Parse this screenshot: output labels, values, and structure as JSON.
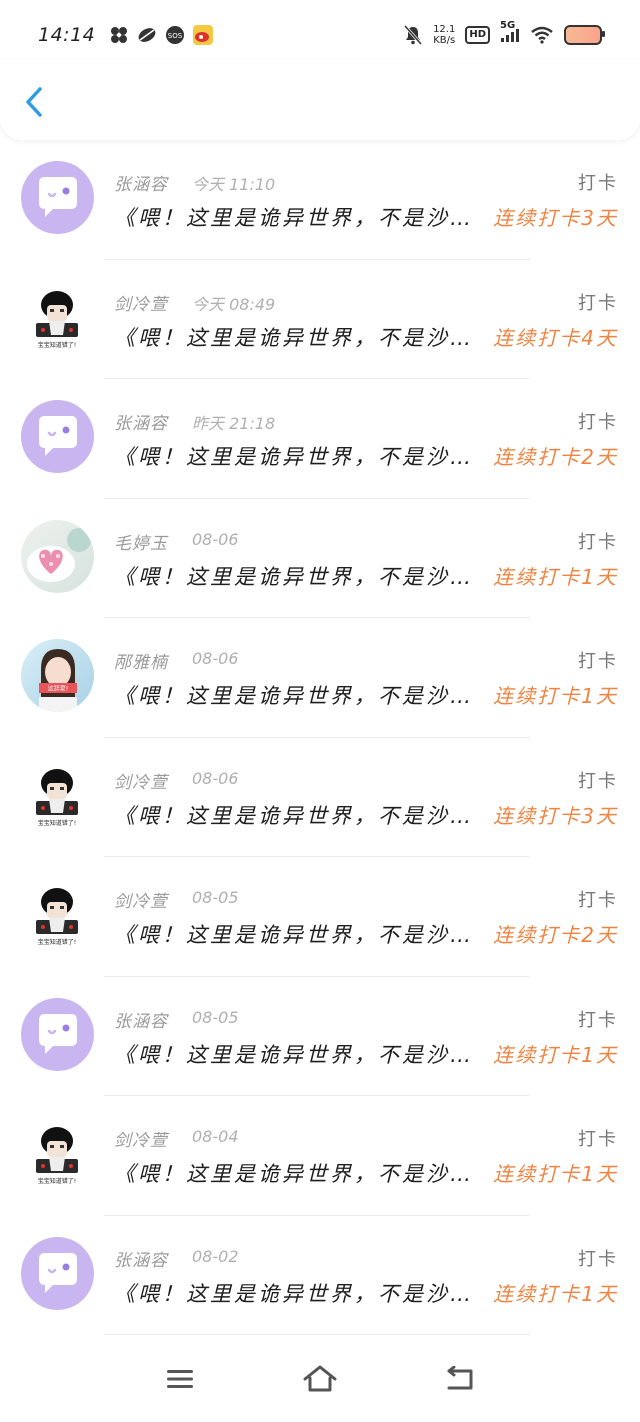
{
  "status_bar": {
    "time": "14:14",
    "speed_value": "12.1",
    "speed_unit": "KB/s",
    "hd": "HD",
    "net": "5G",
    "sos": "SOS",
    "icons": [
      "pinwheel-icon",
      "leaf-icon",
      "sos-icon",
      "weibo-icon",
      "mute-icon",
      "signal-icon",
      "wifi-icon",
      "battery-icon"
    ]
  },
  "header": {
    "back_icon": "chevron-left-icon"
  },
  "list": [
    {
      "avatar": "purple",
      "name": "张涵容",
      "time": "今天 11:10",
      "tag": "打卡",
      "title": "《喂！这里是诡异世界，不是沙…",
      "streak": "连续打卡3天"
    },
    {
      "avatar": "meme",
      "name": "剑冷萱",
      "time": "今天 08:49",
      "tag": "打卡",
      "title": "《喂！这里是诡异世界，不是沙…",
      "streak": "连续打卡4天"
    },
    {
      "avatar": "purple",
      "name": "张涵容",
      "time": "昨天 21:18",
      "tag": "打卡",
      "title": "《喂！这里是诡异世界，不是沙…",
      "streak": "连续打卡2天"
    },
    {
      "avatar": "cake",
      "name": "毛婷玉",
      "time": "08-06",
      "tag": "打卡",
      "title": "《喂！这里是诡异世界，不是沙…",
      "streak": "连续打卡1天"
    },
    {
      "avatar": "girl",
      "name": "邴雅楠",
      "time": "08-06",
      "tag": "打卡",
      "title": "《喂！这里是诡异世界，不是沙…",
      "streak": "连续打卡1天"
    },
    {
      "avatar": "meme",
      "name": "剑冷萱",
      "time": "08-06",
      "tag": "打卡",
      "title": "《喂！这里是诡异世界，不是沙…",
      "streak": "连续打卡3天"
    },
    {
      "avatar": "meme",
      "name": "剑冷萱",
      "time": "08-05",
      "tag": "打卡",
      "title": "《喂！这里是诡异世界，不是沙…",
      "streak": "连续打卡2天"
    },
    {
      "avatar": "purple",
      "name": "张涵容",
      "time": "08-05",
      "tag": "打卡",
      "title": "《喂！这里是诡异世界，不是沙…",
      "streak": "连续打卡1天"
    },
    {
      "avatar": "meme",
      "name": "剑冷萱",
      "time": "08-04",
      "tag": "打卡",
      "title": "《喂！这里是诡异世界，不是沙…",
      "streak": "连续打卡1天"
    },
    {
      "avatar": "purple",
      "name": "张涵容",
      "time": "08-02",
      "tag": "打卡",
      "title": "《喂！这里是诡异世界，不是沙…",
      "streak": "连续打卡1天"
    }
  ],
  "meme_caption": "宝宝知道错了!",
  "girl_caption": "这辞夏!",
  "nav": {
    "menu_icon": "menu-icon",
    "home_icon": "home-icon",
    "back_icon": "back-icon"
  },
  "colors": {
    "accent": "#2f9be4",
    "streak": "#ef8442",
    "avatar_purple": "#c9b5ef"
  }
}
